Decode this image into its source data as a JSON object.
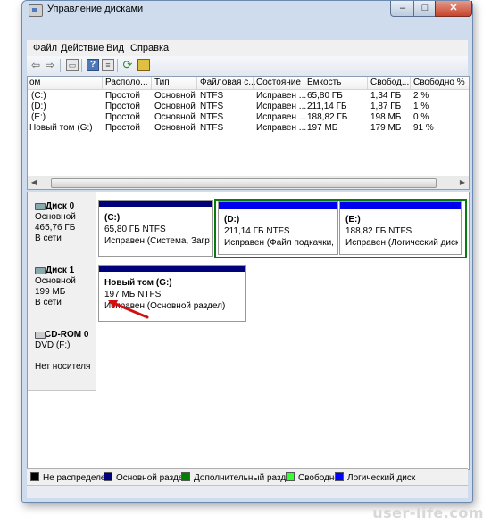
{
  "window": {
    "title": "Управление дисками"
  },
  "menu": [
    "Файл",
    "Действие",
    "Вид",
    "Справка"
  ],
  "toolbar": {
    "icons": [
      "back-icon",
      "forward-icon",
      "properties-icon",
      "help-icon",
      "list-icon",
      "rescan-icon",
      "action-icon"
    ]
  },
  "volumes": {
    "columns": [
      "ом",
      "Располо...",
      "Тип",
      "Файловая с...",
      "Состояние",
      "Емкость",
      "Свобод...",
      "Свободно %"
    ],
    "rows": [
      [
        "(C:)",
        "Простой",
        "Основной",
        "NTFS",
        "Исправен ...",
        "65,80 ГБ",
        "1,34 ГБ",
        "2 %"
      ],
      [
        "(D:)",
        "Простой",
        "Основной",
        "NTFS",
        "Исправен ...",
        "211,14 ГБ",
        "1,87 ГБ",
        "1 %"
      ],
      [
        "(E:)",
        "Простой",
        "Основной",
        "NTFS",
        "Исправен ...",
        "188,82 ГБ",
        "198 МБ",
        "0 %"
      ],
      [
        "Новый том (G:)",
        "Простой",
        "Основной",
        "NTFS",
        "Исправен ...",
        "197 МБ",
        "179 МБ",
        "91 %"
      ]
    ]
  },
  "disks": [
    {
      "name": "Диск 0",
      "type": "Основной",
      "size": "465,76 ГБ",
      "status": "В сети",
      "partitions": [
        {
          "name": "(C:)",
          "size": "65,80 ГБ NTFS",
          "status": "Исправен (Система, Загрузк"
        },
        {
          "name": "(D:)",
          "size": "211,14 ГБ NTFS",
          "status": "Исправен (Файл подкачки, Лог"
        },
        {
          "name": "(E:)",
          "size": "188,82 ГБ NTFS",
          "status": "Исправен (Логический диск)"
        }
      ]
    },
    {
      "name": "Диск 1",
      "type": "Основной",
      "size": "199 МБ",
      "status": "В сети",
      "partitions": [
        {
          "name": "Новый том  (G:)",
          "size": "197 МБ NTFS",
          "status": "Исправен (Основной раздел)"
        }
      ]
    },
    {
      "name": "CD-ROM 0",
      "type": "DVD (F:)",
      "size": "",
      "status": "Нет носителя"
    }
  ],
  "legend": [
    {
      "label": "Не распределен",
      "color": "#000000"
    },
    {
      "label": "Основной раздел",
      "color": "#000080"
    },
    {
      "label": "Дополнительный раздел",
      "color": "#008000"
    },
    {
      "label": "Свободно",
      "color": "#33ff33"
    },
    {
      "label": "Логический диск",
      "color": "#0000ff"
    }
  ],
  "colors": {
    "primary_bar": "#00007a",
    "logical_bar": "#0000ee",
    "extended_frame": "#0a7a10",
    "arrow": "#d01010"
  },
  "watermark": "user-life.com"
}
